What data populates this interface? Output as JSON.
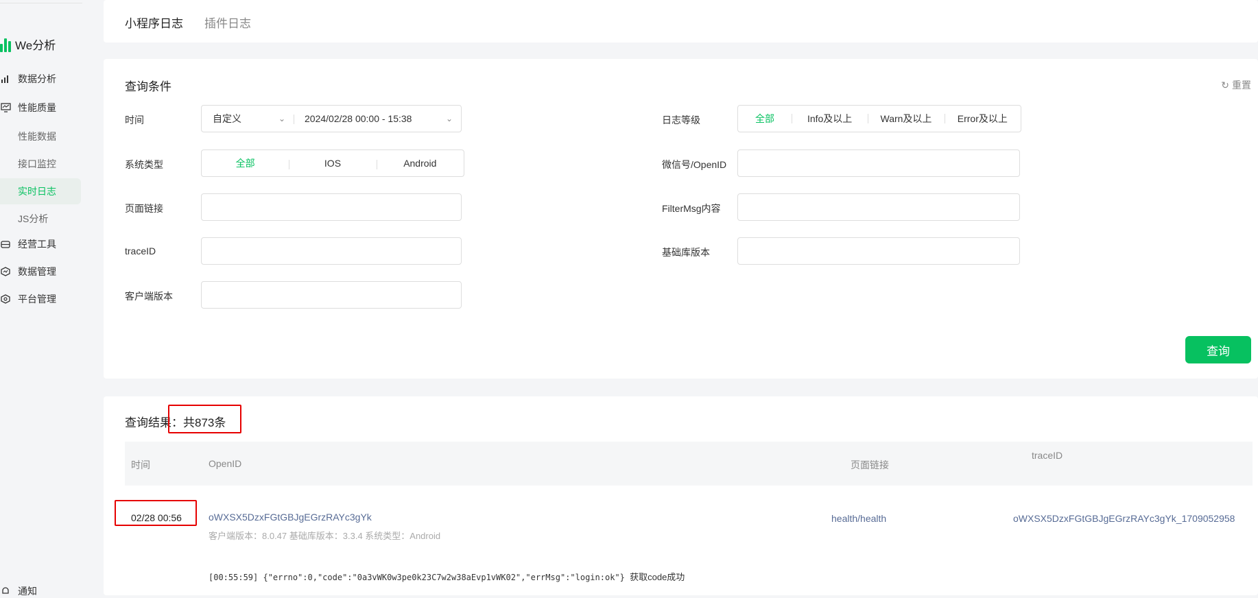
{
  "sidebar": {
    "brand": "We分析",
    "items": [
      {
        "label": "数据分析",
        "icon": "bar-chart-icon"
      },
      {
        "label": "性能质量",
        "icon": "monitor-icon"
      },
      {
        "label": "经营工具",
        "icon": "toolbox-icon"
      },
      {
        "label": "数据管理",
        "icon": "data-shield-icon"
      },
      {
        "label": "平台管理",
        "icon": "settings-hex-icon"
      }
    ],
    "subitems": [
      "性能数据",
      "接口监控",
      "实时日志",
      "JS分析"
    ],
    "active_subitem": "实时日志",
    "bottom_item": "通知"
  },
  "tabs": [
    "小程序日志",
    "插件日志"
  ],
  "active_tab": "小程序日志",
  "query": {
    "title": "查询条件",
    "reset_label": "重置",
    "time": {
      "label": "时间",
      "mode": "自定义",
      "range": "2024/02/28 00:00 - 15:38"
    },
    "log_level": {
      "label": "日志等级",
      "options": [
        "全部",
        "Info及以上",
        "Warn及以上",
        "Error及以上"
      ],
      "selected": "全部"
    },
    "system_type": {
      "label": "系统类型",
      "options": [
        "全部",
        "IOS",
        "Android"
      ],
      "selected": "全部"
    },
    "fields": {
      "wechat_openid": {
        "label": "微信号/OpenID",
        "value": ""
      },
      "page_link": {
        "label": "页面链接",
        "value": ""
      },
      "filter_msg": {
        "label": "FilterMsg内容",
        "value": ""
      },
      "trace_id": {
        "label": "traceID",
        "value": ""
      },
      "base_lib_version": {
        "label": "基础库版本",
        "value": ""
      },
      "client_version": {
        "label": "客户端版本",
        "value": ""
      }
    },
    "submit_label": "查询"
  },
  "results": {
    "title_prefix": "查询结果：",
    "count_text": "共873条",
    "columns": [
      "时间",
      "OpenID",
      "页面链接",
      "traceID"
    ],
    "rows": [
      {
        "time": "02/28 00:56",
        "openid": "oWXSX5DzxFGtGBJgEGrzRAYc3gYk",
        "meta": "客户端版本：8.0.47 基础库版本：3.3.4 系统类型：Android",
        "page": "health/health",
        "trace_id": "oWXSX5DzxFGtGBJgEGrzRAYc3gYk_1709052958",
        "log": "[00:55:59] {\"errno\":0,\"code\":\"0a3vWK0w3pe0k23C7w2w38aEvp1vWK02\",\"errMsg\":\"login:ok\"}",
        "log_note": "获取code成功"
      }
    ]
  },
  "colors": {
    "accent": "#07c160",
    "highlight_box": "#e60000",
    "link": "#576b95"
  }
}
